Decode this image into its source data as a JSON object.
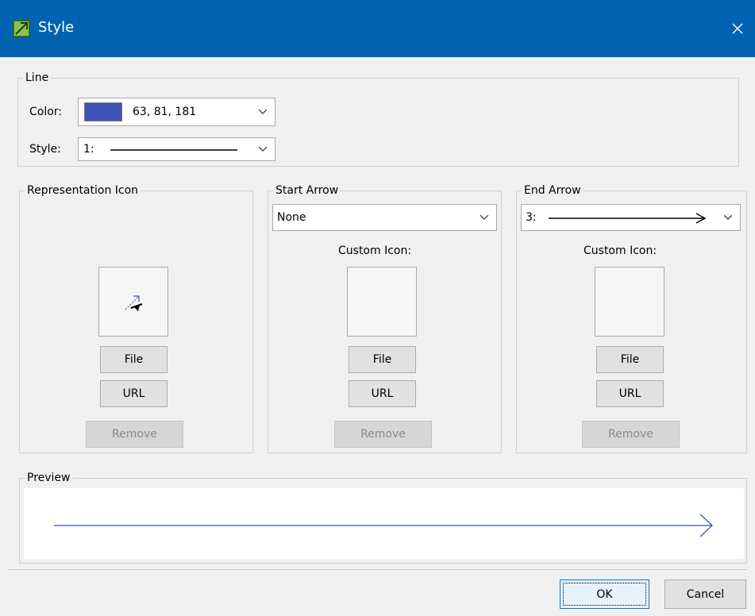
{
  "window": {
    "title": "Style"
  },
  "line_group": {
    "title": "Line",
    "color_label": "Color:",
    "color_value": "63, 81, 181",
    "color_hex": "#3f51b5",
    "style_label": "Style:",
    "style_value": "1:"
  },
  "representation": {
    "title": "Representation Icon",
    "file_label": "File",
    "url_label": "URL",
    "remove_label": "Remove"
  },
  "start_arrow": {
    "title": "Start Arrow",
    "selected": "None",
    "custom_icon_label": "Custom Icon:",
    "file_label": "File",
    "url_label": "URL",
    "remove_label": "Remove"
  },
  "end_arrow": {
    "title": "End Arrow",
    "selected": "3:",
    "custom_icon_label": "Custom Icon:",
    "file_label": "File",
    "url_label": "URL",
    "remove_label": "Remove"
  },
  "preview": {
    "title": "Preview",
    "line_color": "#3f51b5"
  },
  "footer": {
    "ok_label": "OK",
    "cancel_label": "Cancel"
  }
}
